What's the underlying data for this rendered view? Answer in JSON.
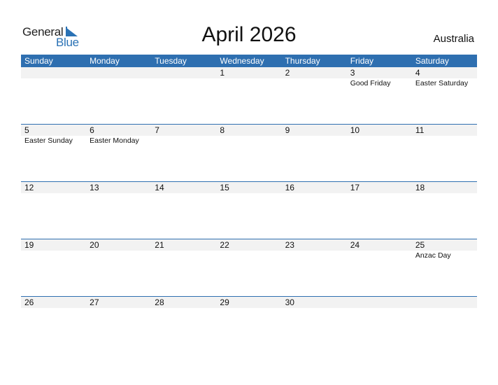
{
  "logo": {
    "word1": "General",
    "word2": "Blue",
    "accent_color": "#2a72b5"
  },
  "title": "April 2026",
  "country": "Australia",
  "weekdays": [
    "Sunday",
    "Monday",
    "Tuesday",
    "Wednesday",
    "Thursday",
    "Friday",
    "Saturday"
  ],
  "weeks": [
    [
      {
        "day": "",
        "holiday": ""
      },
      {
        "day": "",
        "holiday": ""
      },
      {
        "day": "",
        "holiday": ""
      },
      {
        "day": "1",
        "holiday": ""
      },
      {
        "day": "2",
        "holiday": ""
      },
      {
        "day": "3",
        "holiday": "Good Friday"
      },
      {
        "day": "4",
        "holiday": "Easter Saturday"
      }
    ],
    [
      {
        "day": "5",
        "holiday": "Easter Sunday"
      },
      {
        "day": "6",
        "holiday": "Easter Monday"
      },
      {
        "day": "7",
        "holiday": ""
      },
      {
        "day": "8",
        "holiday": ""
      },
      {
        "day": "9",
        "holiday": ""
      },
      {
        "day": "10",
        "holiday": ""
      },
      {
        "day": "11",
        "holiday": ""
      }
    ],
    [
      {
        "day": "12",
        "holiday": ""
      },
      {
        "day": "13",
        "holiday": ""
      },
      {
        "day": "14",
        "holiday": ""
      },
      {
        "day": "15",
        "holiday": ""
      },
      {
        "day": "16",
        "holiday": ""
      },
      {
        "day": "17",
        "holiday": ""
      },
      {
        "day": "18",
        "holiday": ""
      }
    ],
    [
      {
        "day": "19",
        "holiday": ""
      },
      {
        "day": "20",
        "holiday": ""
      },
      {
        "day": "21",
        "holiday": ""
      },
      {
        "day": "22",
        "holiday": ""
      },
      {
        "day": "23",
        "holiday": ""
      },
      {
        "day": "24",
        "holiday": ""
      },
      {
        "day": "25",
        "holiday": "Anzac Day"
      }
    ],
    [
      {
        "day": "26",
        "holiday": ""
      },
      {
        "day": "27",
        "holiday": ""
      },
      {
        "day": "28",
        "holiday": ""
      },
      {
        "day": "29",
        "holiday": ""
      },
      {
        "day": "30",
        "holiday": ""
      },
      {
        "day": "",
        "holiday": ""
      },
      {
        "day": "",
        "holiday": ""
      }
    ]
  ]
}
